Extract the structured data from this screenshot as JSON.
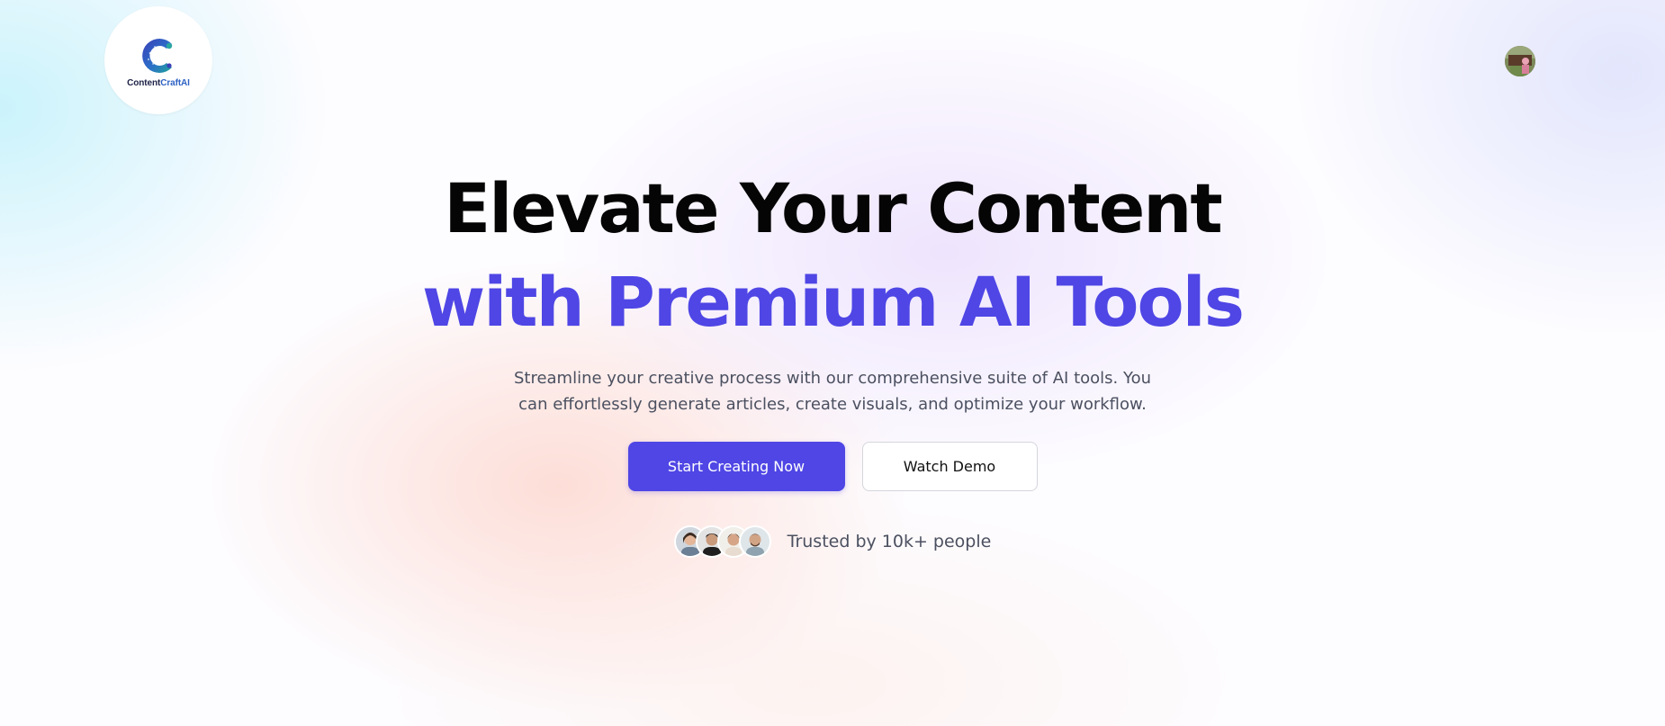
{
  "header": {
    "logo": {
      "name_part1": "Content",
      "name_part2": "CraftAI",
      "icon": "letter-c-logo-icon"
    },
    "profile_avatar": "user-avatar-icon"
  },
  "hero": {
    "headline_line1": "Elevate Your Content",
    "headline_line2": "with Premium AI Tools",
    "subtext": "Streamline your creative process with our comprehensive suite of AI tools. You can effortlessly generate articles, create visuals, and optimize your workflow.",
    "primary_button": "Start Creating Now",
    "secondary_button": "Watch Demo",
    "trusted_text": "Trusted by 10k+ people",
    "trusted_avatars": [
      "person-avatar-icon",
      "person-avatar-icon",
      "person-avatar-icon",
      "person-avatar-icon"
    ]
  },
  "colors": {
    "accent": "#4f46e5",
    "headline": "#050505",
    "body_text": "#4b5060"
  }
}
